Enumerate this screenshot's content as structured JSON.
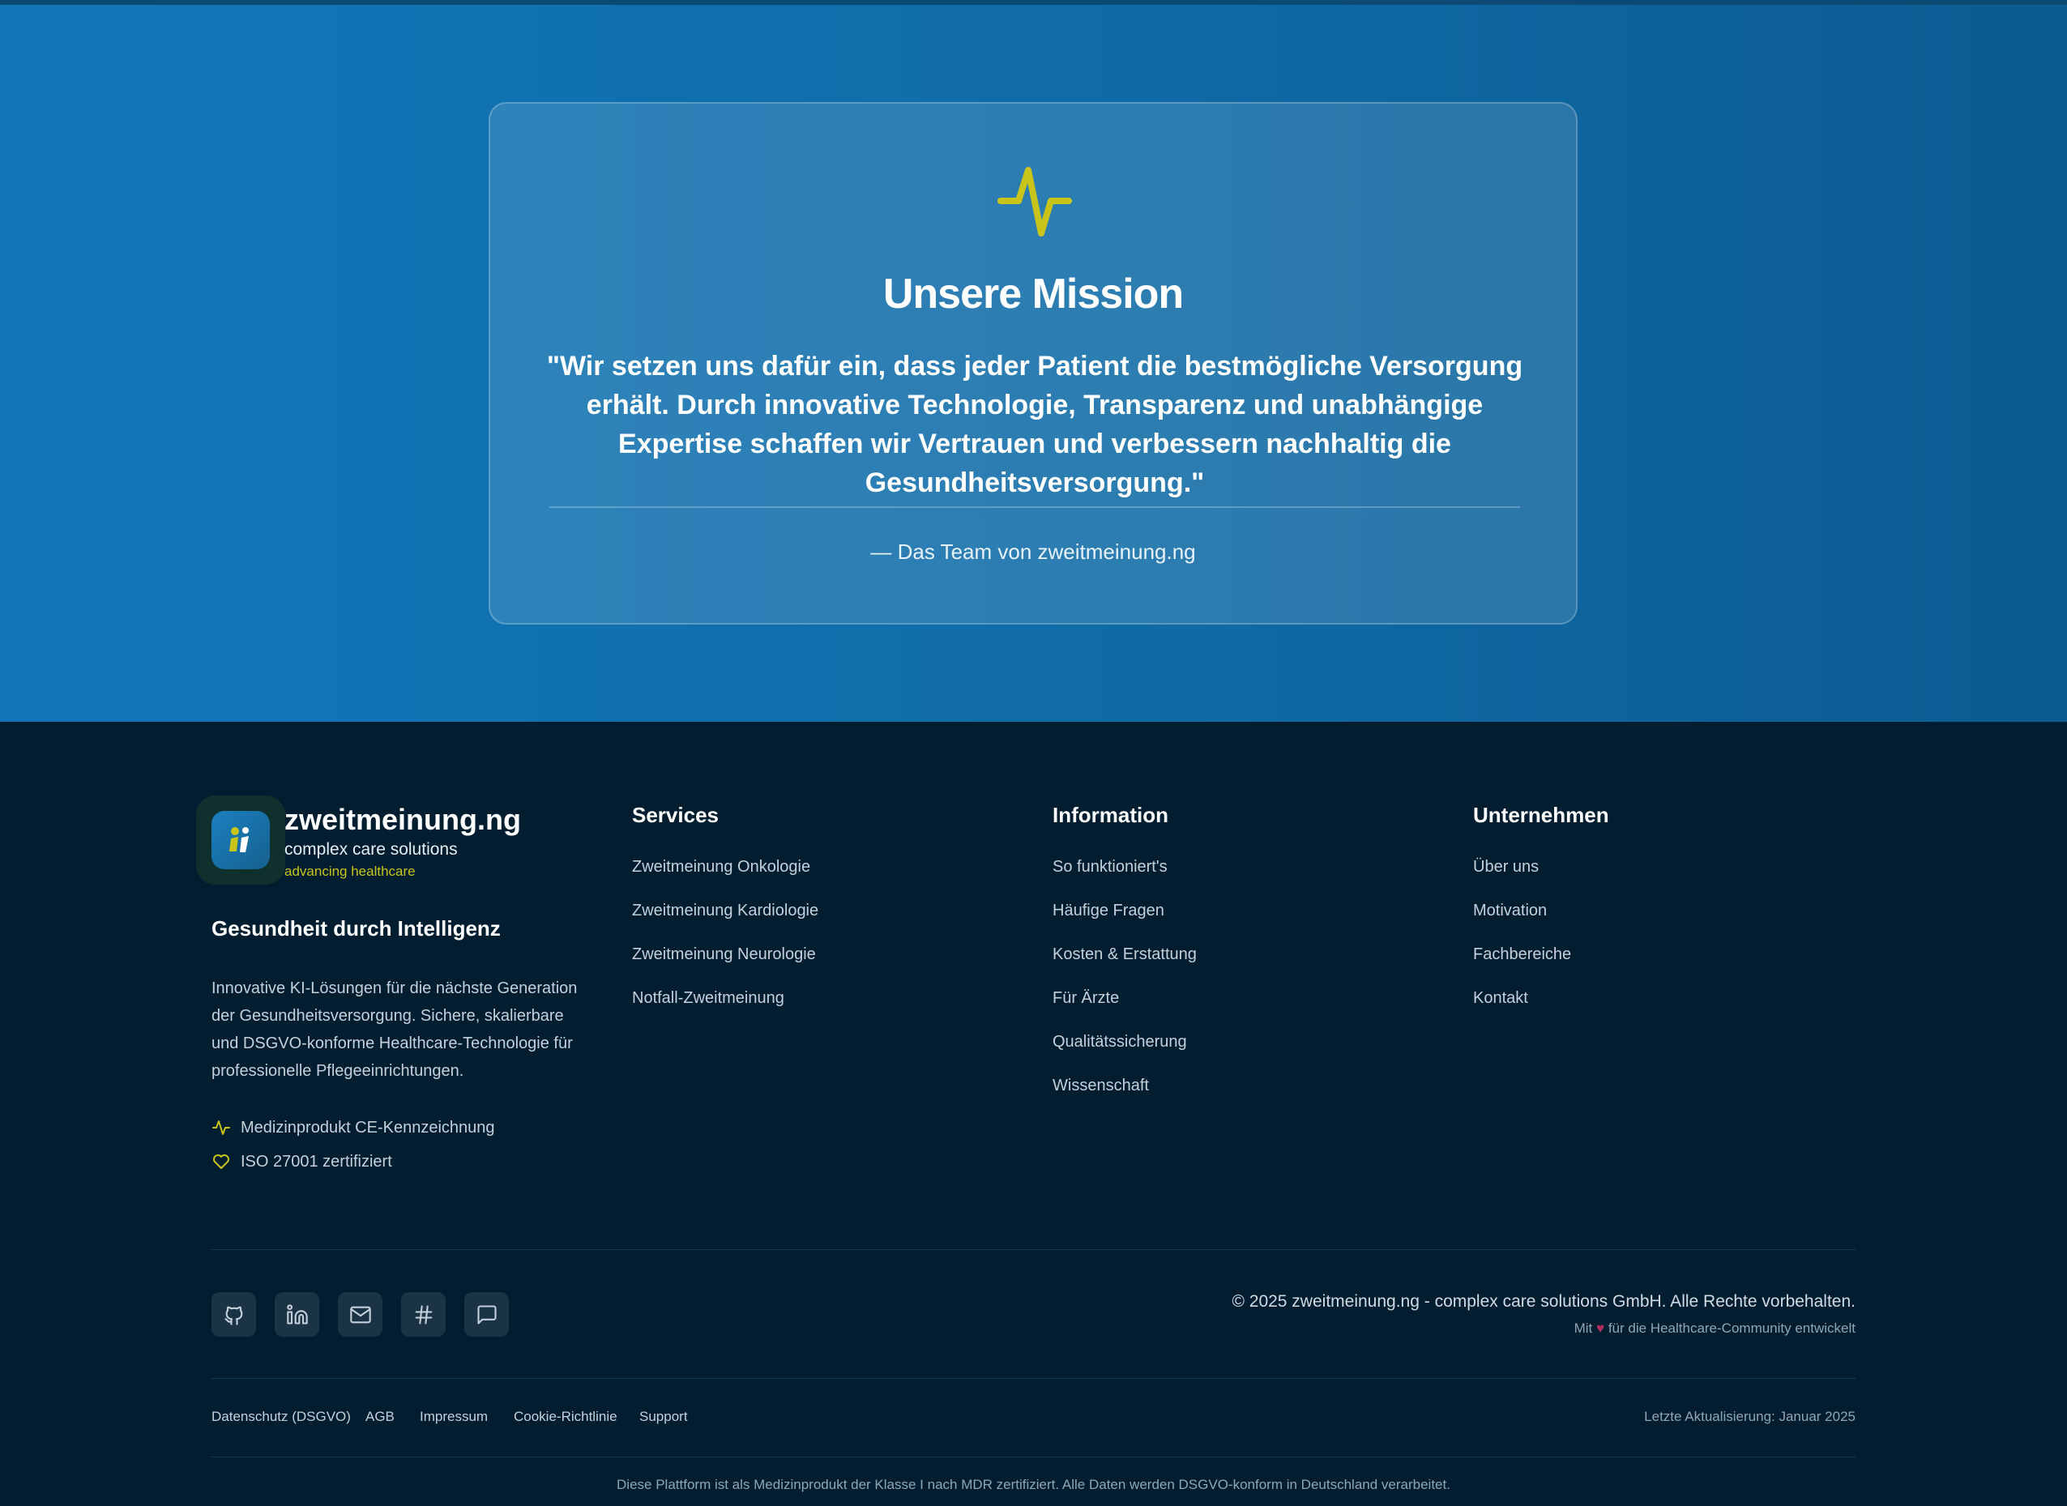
{
  "colors": {
    "accent": "#c8c41a",
    "hero_bg": "#1277ba",
    "footer_bg": "#011e30",
    "heart": "#b52e62"
  },
  "mission": {
    "icon": "activity-pulse-icon",
    "title": "Unsere Mission",
    "quote": "\"Wir setzen uns dafür ein, dass jeder Patient die bestmögliche Versorgung erhält. Durch innovative Technologie, Transparenz und unabhängige Expertise schaffen wir Vertrauen und verbessern nachhaltig die Gesundheitsversorgung.\"",
    "author": "— Das Team von zweitmeinung.ng"
  },
  "brand": {
    "name": "zweitmeinung.ng",
    "subtitle": "complex care solutions",
    "tag": "advancing healthcare",
    "tagline": "Gesundheit durch Intelligenz",
    "description": "Innovative KI-Lösungen für die nächste Generation der Gesundheitsversorgung. Sichere, skalierbare und DSGVO-konforme Healthcare-Technologie für professionelle Pflegeeinrichtungen.",
    "badges": [
      {
        "icon": "activity-icon",
        "label": "Medizinprodukt CE-Kennzeichnung"
      },
      {
        "icon": "heart-icon",
        "label": "ISO 27001 zertifiziert"
      }
    ]
  },
  "columns": {
    "services": {
      "title": "Services",
      "links": [
        "Zweitmeinung Onkologie",
        "Zweitmeinung Kardiologie",
        "Zweitmeinung Neurologie",
        "Notfall-Zweitmeinung"
      ]
    },
    "information": {
      "title": "Information",
      "links": [
        "So funktioniert's",
        "Häufige Fragen",
        "Kosten & Erstattung",
        "Für Ärzte",
        "Qualitätssicherung",
        "Wissenschaft"
      ]
    },
    "company": {
      "title": "Unternehmen",
      "links": [
        "Über uns",
        "Motivation",
        "Fachbereiche",
        "Kontakt"
      ]
    }
  },
  "social": [
    "github-icon",
    "linkedin-icon",
    "mail-icon",
    "hash-icon",
    "chat-icon"
  ],
  "copyright": "© 2025 zweitmeinung.ng - complex care solutions GmbH. Alle Rechte vorbehalten.",
  "made_with": {
    "prefix": "Mit",
    "suffix": "für die Healthcare-Community entwickelt"
  },
  "legal": [
    "Datenschutz (DSGVO)",
    "AGB",
    "Impressum",
    "Cookie-Richtlinie",
    "Support"
  ],
  "updated": "Letzte Aktualisierung: Januar 2025",
  "disclaimer": "Diese Plattform ist als Medizinprodukt der Klasse I nach MDR zertifiziert. Alle Daten werden DSGVO-konform in Deutschland verarbeitet."
}
